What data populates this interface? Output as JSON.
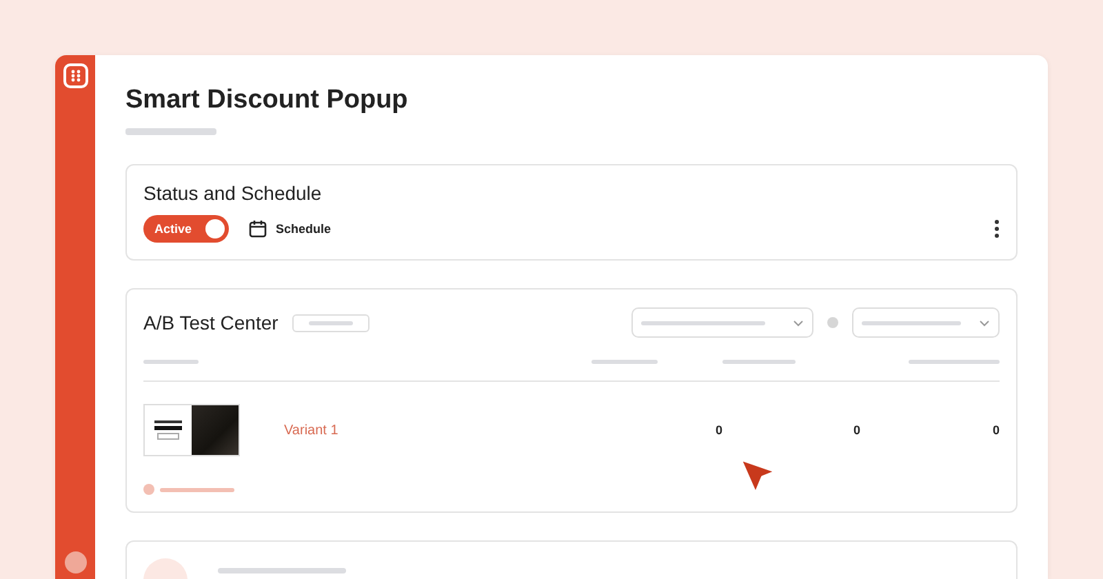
{
  "page": {
    "title": "Smart Discount Popup"
  },
  "status_card": {
    "title": "Status and Schedule",
    "toggle": {
      "label": "Active",
      "on": true
    },
    "schedule": {
      "label": "Schedule"
    }
  },
  "ab_test": {
    "title": "A/B Test Center",
    "variants": [
      {
        "name": "Variant 1",
        "column_1": "0",
        "column_2": "0",
        "column_3": "0"
      }
    ]
  }
}
